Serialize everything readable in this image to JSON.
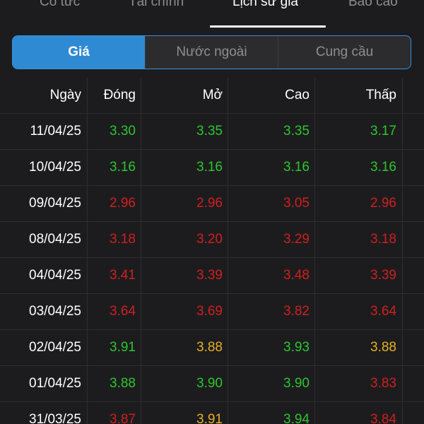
{
  "top_tabs": [
    {
      "label": "Cổ tức",
      "active": false
    },
    {
      "label": "Tài chính",
      "active": false
    },
    {
      "label": "Lịch sử giá",
      "active": true
    },
    {
      "label": "Báo cáo",
      "active": false
    }
  ],
  "segments": [
    {
      "label": "Giá",
      "active": true
    },
    {
      "label": "Nước ngoài",
      "active": false
    },
    {
      "label": "Cung cầu",
      "active": false
    }
  ],
  "table": {
    "headers": [
      "Ngày",
      "Đóng",
      "Mở",
      "Cao",
      "Thấp"
    ],
    "rows": [
      {
        "date": "11/04/25",
        "close": {
          "v": "3.30",
          "c": "up"
        },
        "open": {
          "v": "3.35",
          "c": "up"
        },
        "high": {
          "v": "3.35",
          "c": "up"
        },
        "low": {
          "v": "3.17",
          "c": "up"
        }
      },
      {
        "date": "10/04/25",
        "close": {
          "v": "3.16",
          "c": "up"
        },
        "open": {
          "v": "3.16",
          "c": "up"
        },
        "high": {
          "v": "3.16",
          "c": "up"
        },
        "low": {
          "v": "3.16",
          "c": "up"
        }
      },
      {
        "date": "09/04/25",
        "close": {
          "v": "2.96",
          "c": "down"
        },
        "open": {
          "v": "2.96",
          "c": "down"
        },
        "high": {
          "v": "3.05",
          "c": "down"
        },
        "low": {
          "v": "2.96",
          "c": "down"
        }
      },
      {
        "date": "08/04/25",
        "close": {
          "v": "3.18",
          "c": "down"
        },
        "open": {
          "v": "3.20",
          "c": "down"
        },
        "high": {
          "v": "3.29",
          "c": "down"
        },
        "low": {
          "v": "3.18",
          "c": "down"
        }
      },
      {
        "date": "04/04/25",
        "close": {
          "v": "3.41",
          "c": "down"
        },
        "open": {
          "v": "3.39",
          "c": "down"
        },
        "high": {
          "v": "3.48",
          "c": "down"
        },
        "low": {
          "v": "3.39",
          "c": "down"
        }
      },
      {
        "date": "03/04/25",
        "close": {
          "v": "3.64",
          "c": "down"
        },
        "open": {
          "v": "3.69",
          "c": "down"
        },
        "high": {
          "v": "3.82",
          "c": "down"
        },
        "low": {
          "v": "3.64",
          "c": "down"
        }
      },
      {
        "date": "02/04/25",
        "close": {
          "v": "3.91",
          "c": "up"
        },
        "open": {
          "v": "3.88",
          "c": "ref"
        },
        "high": {
          "v": "3.93",
          "c": "up"
        },
        "low": {
          "v": "3.88",
          "c": "ref"
        }
      },
      {
        "date": "01/04/25",
        "close": {
          "v": "3.88",
          "c": "up"
        },
        "open": {
          "v": "3.90",
          "c": "up"
        },
        "high": {
          "v": "3.90",
          "c": "up"
        },
        "low": {
          "v": "3.83",
          "c": "down"
        }
      },
      {
        "date": "31/03/25",
        "close": {
          "v": "3.87",
          "c": "down"
        },
        "open": {
          "v": "3.91",
          "c": "ref"
        },
        "high": {
          "v": "3.94",
          "c": "up"
        },
        "low": {
          "v": "3.84",
          "c": "down"
        }
      }
    ]
  },
  "colors": {
    "up": "#2ec52e",
    "down": "#d01f1f",
    "reference": "#e8b021",
    "accent": "#2f8ad4"
  }
}
